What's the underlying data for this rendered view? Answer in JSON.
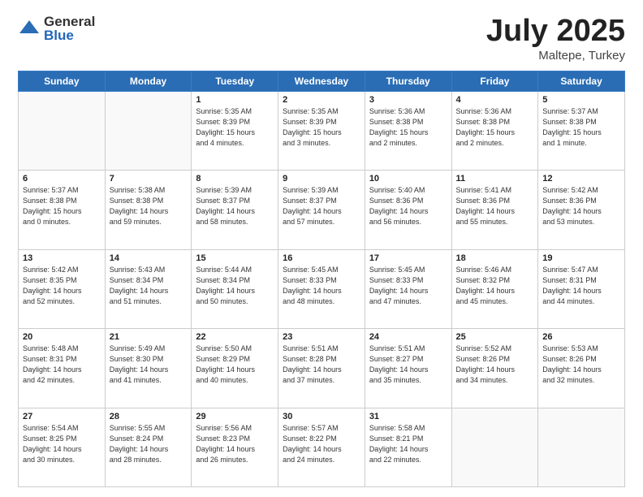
{
  "logo": {
    "general": "General",
    "blue": "Blue"
  },
  "title": {
    "month": "July 2025",
    "location": "Maltepe, Turkey"
  },
  "days_header": [
    "Sunday",
    "Monday",
    "Tuesday",
    "Wednesday",
    "Thursday",
    "Friday",
    "Saturday"
  ],
  "weeks": [
    [
      {
        "num": "",
        "info": ""
      },
      {
        "num": "",
        "info": ""
      },
      {
        "num": "1",
        "info": "Sunrise: 5:35 AM\nSunset: 8:39 PM\nDaylight: 15 hours\nand 4 minutes."
      },
      {
        "num": "2",
        "info": "Sunrise: 5:35 AM\nSunset: 8:39 PM\nDaylight: 15 hours\nand 3 minutes."
      },
      {
        "num": "3",
        "info": "Sunrise: 5:36 AM\nSunset: 8:38 PM\nDaylight: 15 hours\nand 2 minutes."
      },
      {
        "num": "4",
        "info": "Sunrise: 5:36 AM\nSunset: 8:38 PM\nDaylight: 15 hours\nand 2 minutes."
      },
      {
        "num": "5",
        "info": "Sunrise: 5:37 AM\nSunset: 8:38 PM\nDaylight: 15 hours\nand 1 minute."
      }
    ],
    [
      {
        "num": "6",
        "info": "Sunrise: 5:37 AM\nSunset: 8:38 PM\nDaylight: 15 hours\nand 0 minutes."
      },
      {
        "num": "7",
        "info": "Sunrise: 5:38 AM\nSunset: 8:38 PM\nDaylight: 14 hours\nand 59 minutes."
      },
      {
        "num": "8",
        "info": "Sunrise: 5:39 AM\nSunset: 8:37 PM\nDaylight: 14 hours\nand 58 minutes."
      },
      {
        "num": "9",
        "info": "Sunrise: 5:39 AM\nSunset: 8:37 PM\nDaylight: 14 hours\nand 57 minutes."
      },
      {
        "num": "10",
        "info": "Sunrise: 5:40 AM\nSunset: 8:36 PM\nDaylight: 14 hours\nand 56 minutes."
      },
      {
        "num": "11",
        "info": "Sunrise: 5:41 AM\nSunset: 8:36 PM\nDaylight: 14 hours\nand 55 minutes."
      },
      {
        "num": "12",
        "info": "Sunrise: 5:42 AM\nSunset: 8:36 PM\nDaylight: 14 hours\nand 53 minutes."
      }
    ],
    [
      {
        "num": "13",
        "info": "Sunrise: 5:42 AM\nSunset: 8:35 PM\nDaylight: 14 hours\nand 52 minutes."
      },
      {
        "num": "14",
        "info": "Sunrise: 5:43 AM\nSunset: 8:34 PM\nDaylight: 14 hours\nand 51 minutes."
      },
      {
        "num": "15",
        "info": "Sunrise: 5:44 AM\nSunset: 8:34 PM\nDaylight: 14 hours\nand 50 minutes."
      },
      {
        "num": "16",
        "info": "Sunrise: 5:45 AM\nSunset: 8:33 PM\nDaylight: 14 hours\nand 48 minutes."
      },
      {
        "num": "17",
        "info": "Sunrise: 5:45 AM\nSunset: 8:33 PM\nDaylight: 14 hours\nand 47 minutes."
      },
      {
        "num": "18",
        "info": "Sunrise: 5:46 AM\nSunset: 8:32 PM\nDaylight: 14 hours\nand 45 minutes."
      },
      {
        "num": "19",
        "info": "Sunrise: 5:47 AM\nSunset: 8:31 PM\nDaylight: 14 hours\nand 44 minutes."
      }
    ],
    [
      {
        "num": "20",
        "info": "Sunrise: 5:48 AM\nSunset: 8:31 PM\nDaylight: 14 hours\nand 42 minutes."
      },
      {
        "num": "21",
        "info": "Sunrise: 5:49 AM\nSunset: 8:30 PM\nDaylight: 14 hours\nand 41 minutes."
      },
      {
        "num": "22",
        "info": "Sunrise: 5:50 AM\nSunset: 8:29 PM\nDaylight: 14 hours\nand 40 minutes."
      },
      {
        "num": "23",
        "info": "Sunrise: 5:51 AM\nSunset: 8:28 PM\nDaylight: 14 hours\nand 37 minutes."
      },
      {
        "num": "24",
        "info": "Sunrise: 5:51 AM\nSunset: 8:27 PM\nDaylight: 14 hours\nand 35 minutes."
      },
      {
        "num": "25",
        "info": "Sunrise: 5:52 AM\nSunset: 8:26 PM\nDaylight: 14 hours\nand 34 minutes."
      },
      {
        "num": "26",
        "info": "Sunrise: 5:53 AM\nSunset: 8:26 PM\nDaylight: 14 hours\nand 32 minutes."
      }
    ],
    [
      {
        "num": "27",
        "info": "Sunrise: 5:54 AM\nSunset: 8:25 PM\nDaylight: 14 hours\nand 30 minutes."
      },
      {
        "num": "28",
        "info": "Sunrise: 5:55 AM\nSunset: 8:24 PM\nDaylight: 14 hours\nand 28 minutes."
      },
      {
        "num": "29",
        "info": "Sunrise: 5:56 AM\nSunset: 8:23 PM\nDaylight: 14 hours\nand 26 minutes."
      },
      {
        "num": "30",
        "info": "Sunrise: 5:57 AM\nSunset: 8:22 PM\nDaylight: 14 hours\nand 24 minutes."
      },
      {
        "num": "31",
        "info": "Sunrise: 5:58 AM\nSunset: 8:21 PM\nDaylight: 14 hours\nand 22 minutes."
      },
      {
        "num": "",
        "info": ""
      },
      {
        "num": "",
        "info": ""
      }
    ]
  ]
}
